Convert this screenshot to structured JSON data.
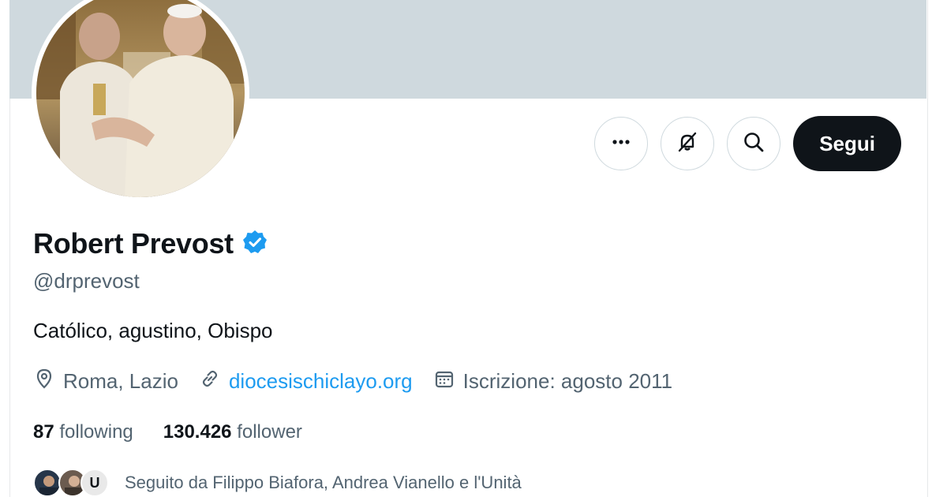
{
  "profile": {
    "name": "Robert Prevost",
    "handle": "@drprevost",
    "bio": "Católico, agustino, Obispo",
    "location": "Roma, Lazio",
    "website": "diocesischiclayo.org",
    "joined": "Iscrizione: agosto 2011",
    "verified_icon": "verified-badge-icon"
  },
  "actions": {
    "more_icon": "more-icon",
    "subscribe_icon": "notifications-off-icon",
    "search_icon": "search-icon",
    "follow_label": "Segui"
  },
  "stats": {
    "following_count": "87",
    "following_label": "following",
    "followers_count": "130.426",
    "followers_label": "follower"
  },
  "followed_by": {
    "text": "Seguito da Filippo Biafora, Andrea Vianello e l'Unità",
    "third_avatar_initial": "U"
  },
  "colors": {
    "banner": "#cfd9de",
    "accent": "#1d9bf0",
    "follow_button": "#0f1419",
    "secondary_text": "#536471"
  }
}
